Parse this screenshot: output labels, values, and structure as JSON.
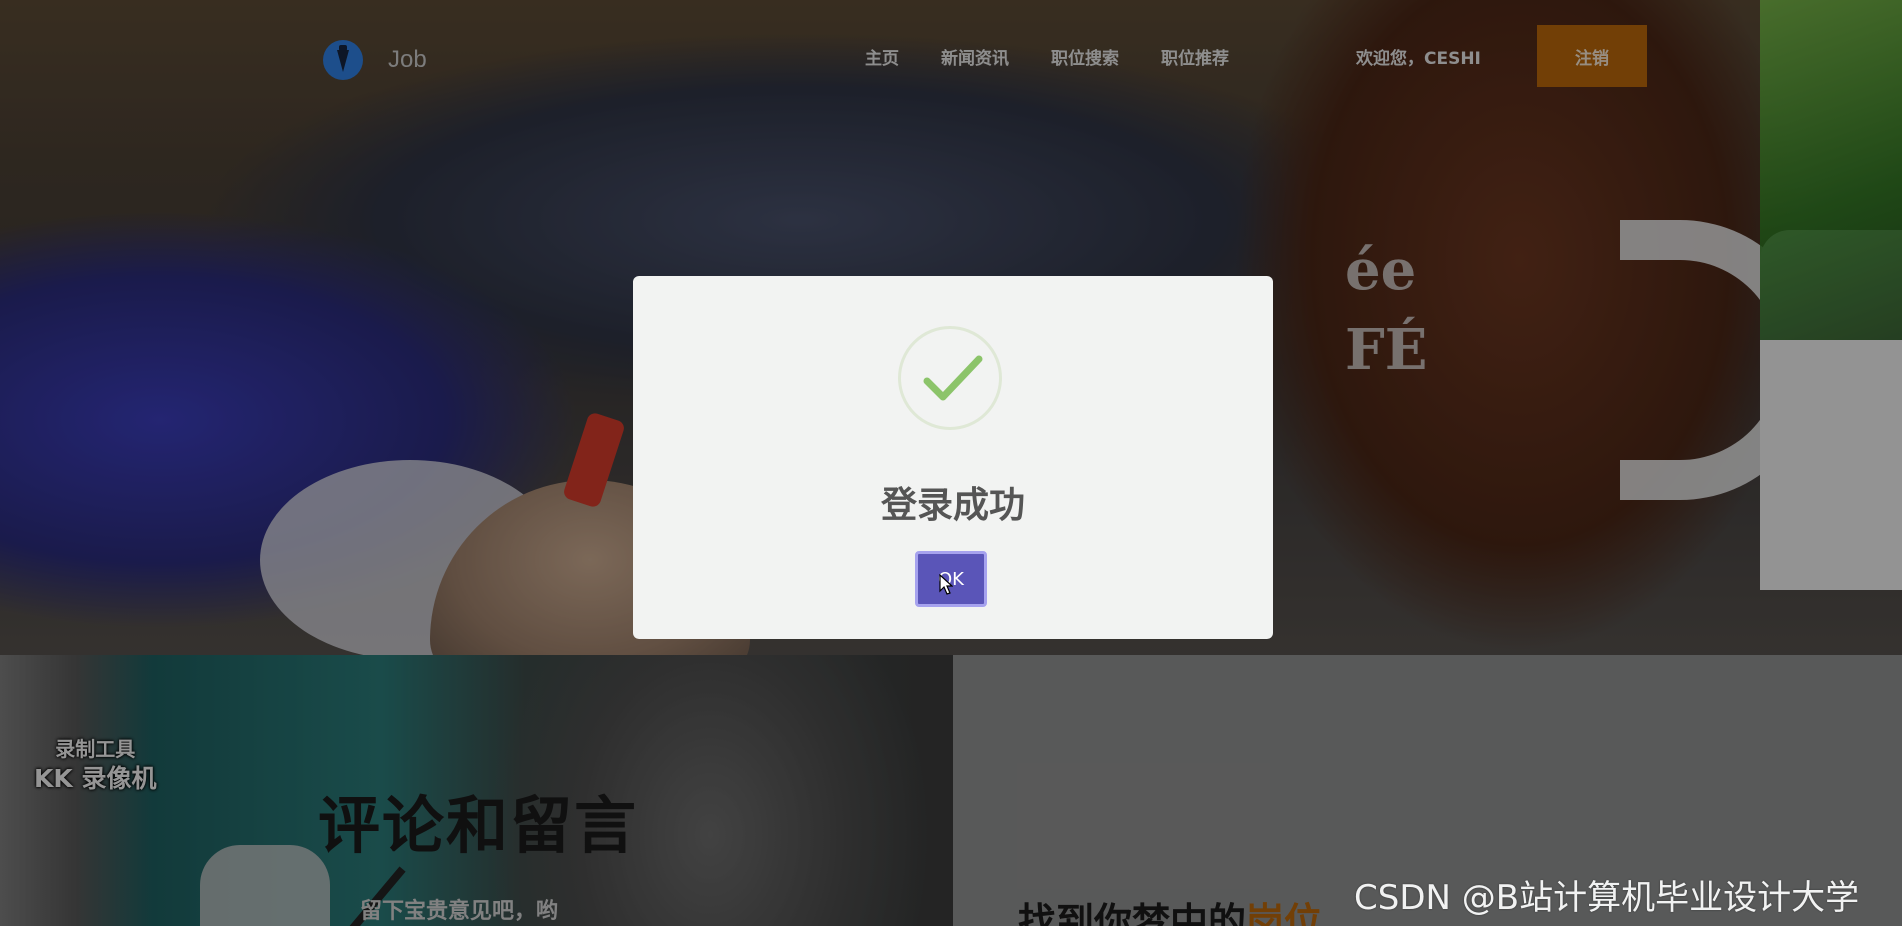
{
  "header": {
    "logo_text": "Job",
    "logo_icon": "tie-icon",
    "nav": [
      {
        "label": "主页"
      },
      {
        "label": "新闻资讯"
      },
      {
        "label": "职位搜索"
      },
      {
        "label": "职位推荐"
      }
    ],
    "welcome_text": "欢迎您，CESHI",
    "logout_label": "注销",
    "accent_color": "#b8660a"
  },
  "hero": {
    "mug_text": "ée\nFÉ"
  },
  "comments": {
    "title": "评论和留言",
    "subtitle": "留下宝贵意见吧，哟"
  },
  "recorder_watermark": {
    "line1": "录制工具",
    "line2": "KK 录像机"
  },
  "find": {
    "prefix": "找到你梦中的",
    "accent": "岗位"
  },
  "modal": {
    "icon": "check-icon",
    "title": "登录成功",
    "ok_label": "OK",
    "button_color": "#5a55b8"
  },
  "site_watermark": "CSDN @B站计算机毕业设计大学"
}
